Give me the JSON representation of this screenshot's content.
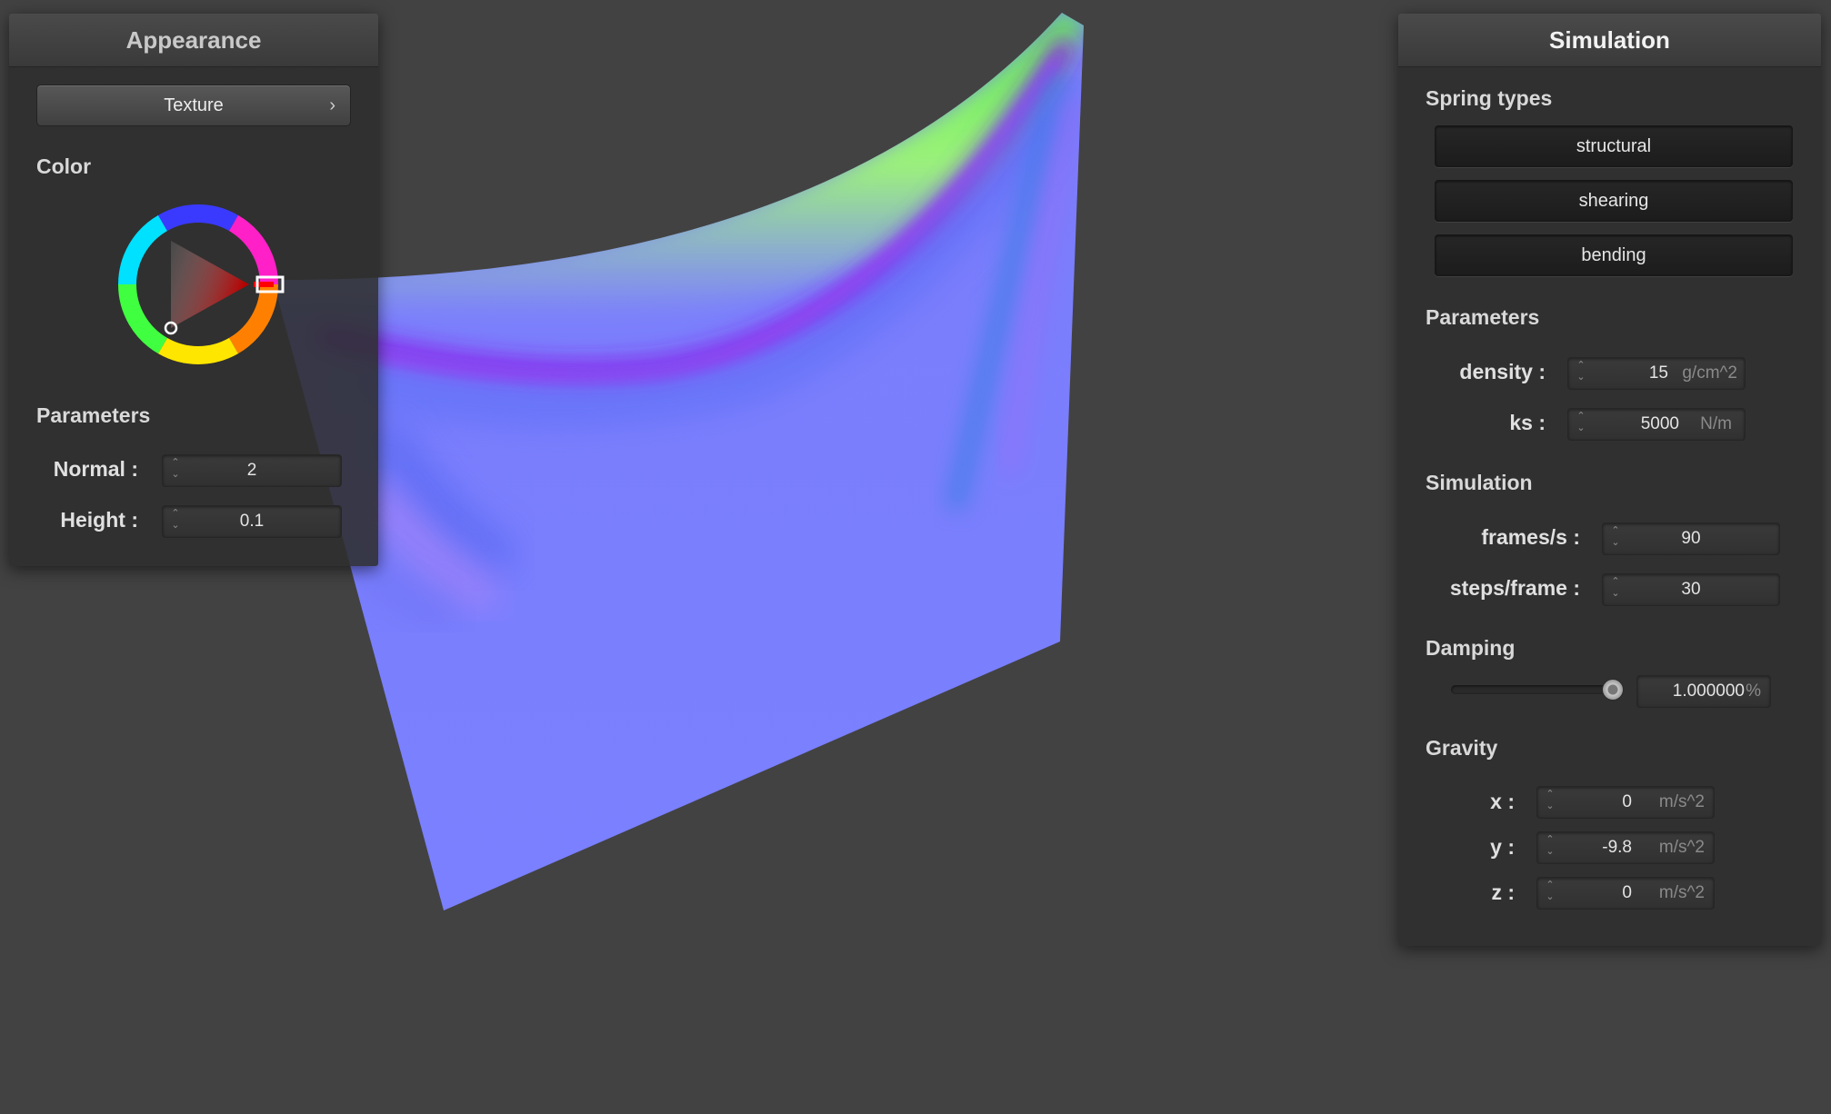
{
  "appearance": {
    "title": "Appearance",
    "texture_button": {
      "label": "Texture",
      "chevron": "›"
    },
    "color_label": "Color",
    "color_wheel": {
      "selected_hue": "#ff0000"
    },
    "parameters_label": "Parameters",
    "normal": {
      "label": "Normal :",
      "value": "2"
    },
    "height": {
      "label": "Height :",
      "value": "0.1"
    }
  },
  "simulation": {
    "title": "Simulation",
    "spring_types_label": "Spring types",
    "spring_types": [
      {
        "label": "structural"
      },
      {
        "label": "shearing"
      },
      {
        "label": "bending"
      }
    ],
    "parameters_label": "Parameters",
    "density": {
      "label": "density :",
      "value": "15",
      "unit": "g/cm^2"
    },
    "ks": {
      "label": "ks :",
      "value": "5000",
      "unit": "N/m"
    },
    "simulation_label": "Simulation",
    "frames_per_s": {
      "label": "frames/s :",
      "value": "90"
    },
    "steps_per_frame": {
      "label": "steps/frame :",
      "value": "30"
    },
    "damping_label": "Damping",
    "damping": {
      "value": "1.000000",
      "unit": "%",
      "slider_fraction": 0.95
    },
    "gravity_label": "Gravity",
    "gravity": [
      {
        "label": "x :",
        "value": "0",
        "unit": "m/s^2"
      },
      {
        "label": "y :",
        "value": "-9.8",
        "unit": "m/s^2"
      },
      {
        "label": "z :",
        "value": "0",
        "unit": "m/s^2"
      }
    ]
  },
  "colors": {
    "background": "#424242",
    "cloth_base": "#7a7cfc",
    "cloth_highlight_green": "#5cf04a",
    "cloth_fold_purple": "#8a1ee6"
  }
}
